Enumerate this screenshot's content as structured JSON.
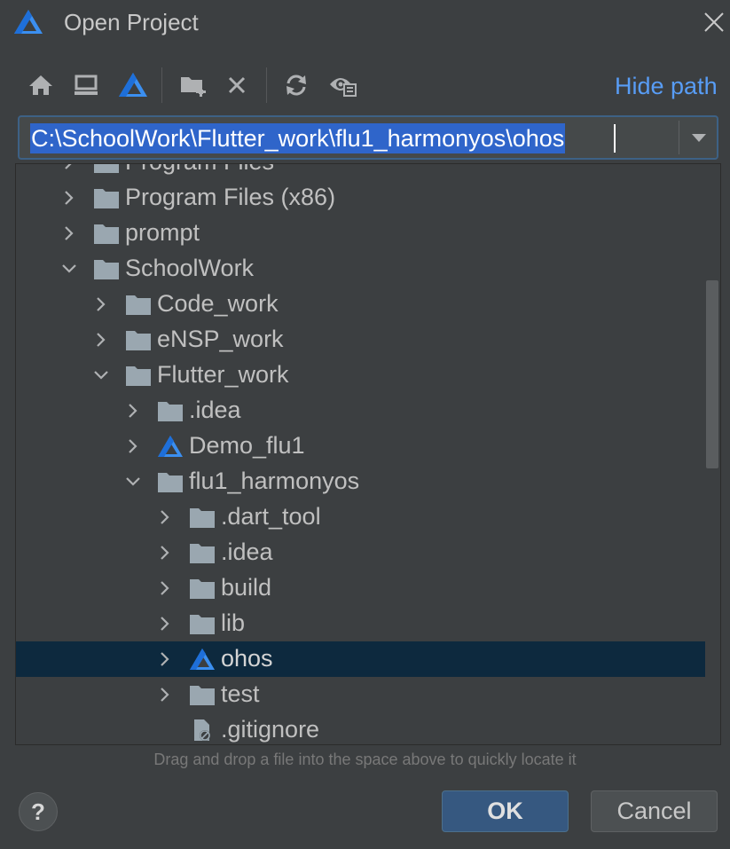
{
  "window": {
    "title": "Open Project",
    "logo_icon": "harmony-logo-icon",
    "close_icon": "close-icon"
  },
  "toolbar": {
    "buttons": [
      {
        "name": "home-button",
        "icon": "home-icon"
      },
      {
        "name": "desktop-button",
        "icon": "desktop-icon"
      },
      {
        "name": "project-button",
        "icon": "harmony-logo-icon"
      },
      {
        "name": "new-folder-button",
        "icon": "new-folder-icon"
      },
      {
        "name": "delete-button",
        "icon": "delete-icon"
      },
      {
        "name": "refresh-button",
        "icon": "refresh-icon"
      },
      {
        "name": "show-hidden-button",
        "icon": "show-hidden-icon"
      }
    ],
    "hide_path_label": "Hide path"
  },
  "path": {
    "value": "C:\\SchoolWork\\Flutter_work\\flu1_harmonyos\\ohos"
  },
  "tree": {
    "rows": [
      {
        "label": "Program Files",
        "level": 0,
        "expanded": false,
        "icon": "folder"
      },
      {
        "label": "Program Files (x86)",
        "level": 0,
        "expanded": false,
        "icon": "folder"
      },
      {
        "label": "prompt",
        "level": 0,
        "expanded": false,
        "icon": "folder"
      },
      {
        "label": "SchoolWork",
        "level": 0,
        "expanded": true,
        "icon": "folder"
      },
      {
        "label": "Code_work",
        "level": 1,
        "expanded": false,
        "icon": "folder"
      },
      {
        "label": "eNSP_work",
        "level": 1,
        "expanded": false,
        "icon": "folder"
      },
      {
        "label": "Flutter_work",
        "level": 1,
        "expanded": true,
        "icon": "folder"
      },
      {
        "label": ".idea",
        "level": 2,
        "expanded": false,
        "icon": "folder"
      },
      {
        "label": "Demo_flu1",
        "level": 2,
        "expanded": false,
        "icon": "project"
      },
      {
        "label": "flu1_harmonyos",
        "level": 2,
        "expanded": true,
        "icon": "folder"
      },
      {
        "label": ".dart_tool",
        "level": 3,
        "expanded": false,
        "icon": "folder"
      },
      {
        "label": ".idea",
        "level": 3,
        "expanded": false,
        "icon": "folder"
      },
      {
        "label": "build",
        "level": 3,
        "expanded": false,
        "icon": "folder"
      },
      {
        "label": "lib",
        "level": 3,
        "expanded": false,
        "icon": "folder"
      },
      {
        "label": "ohos",
        "level": 3,
        "expanded": false,
        "icon": "project",
        "selected": true
      },
      {
        "label": "test",
        "level": 3,
        "expanded": false,
        "icon": "folder"
      },
      {
        "label": ".gitignore",
        "level": 3,
        "expanded": null,
        "icon": "ignored-file"
      }
    ]
  },
  "hint": "Drag and drop a file into the space above to quickly locate it",
  "buttons": {
    "help": "?",
    "ok": "OK",
    "cancel": "Cancel"
  },
  "colors": {
    "background": "#3c3f41",
    "accent_link": "#589df6",
    "selection": "#0d293e",
    "ok_button": "#365880",
    "folder": "#9aa7b0"
  }
}
